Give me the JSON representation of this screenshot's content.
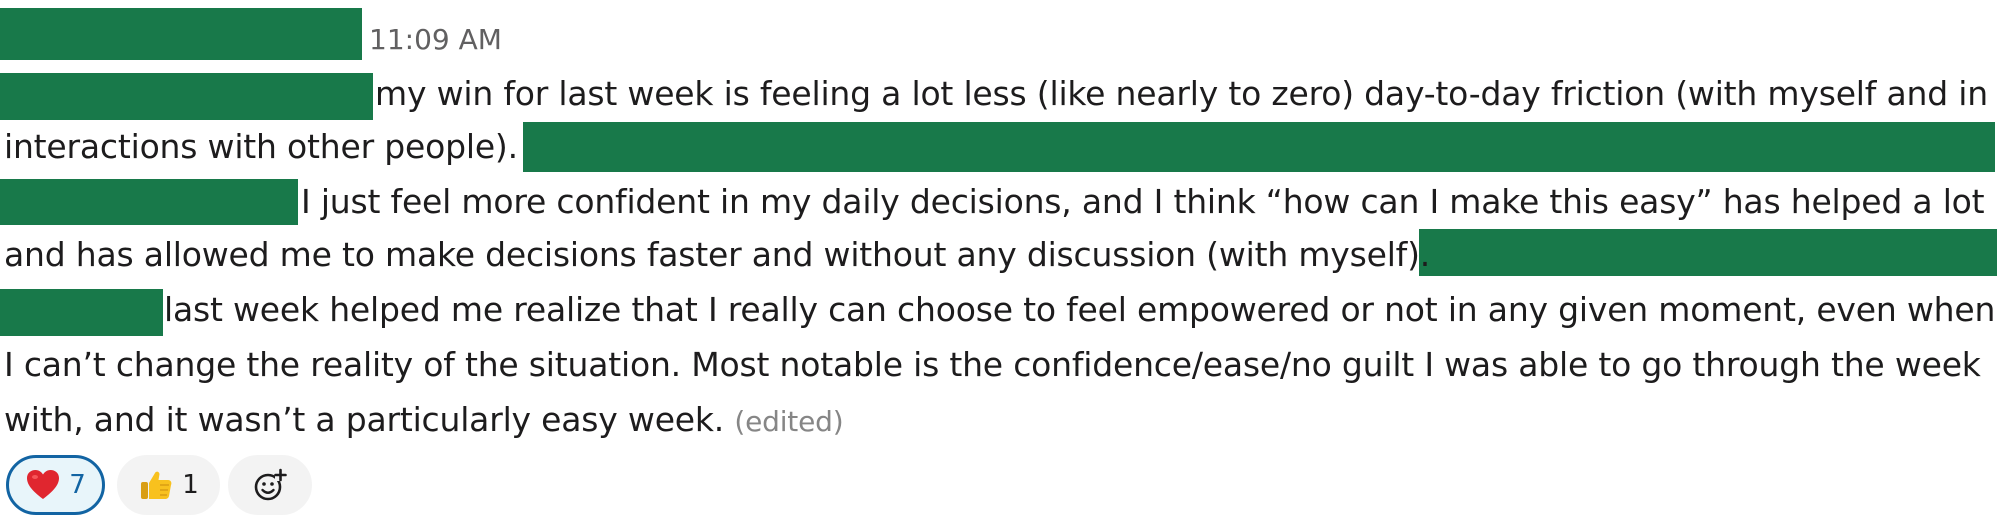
{
  "message": {
    "timestamp": "11:09 AM",
    "lines": [
      "my win for last week is feeling a lot less (like nearly to zero) day-to-day friction (with myself and in",
      "interactions with other people).",
      "I just feel more confident in my daily decisions, and I think “how can I make this easy” has helped a lot",
      "and has allowed me to make decisions faster and without any discussion (with myself).",
      "last week helped me realize that I really can choose to feel empowered or not in any given moment, even when",
      "I can’t change the reality of the situation. Most notable is the confidence/ease/no guilt I was able to go through the week",
      "with, and it wasn’t a particularly easy week."
    ],
    "edited_label": "(edited)"
  },
  "reactions": [
    {
      "emoji": "heart-emoji",
      "count": "7",
      "active": true
    },
    {
      "emoji": "thumbs-up-emoji",
      "count": "1",
      "active": false
    },
    {
      "emoji": "add-reaction-icon",
      "count": "",
      "active": false
    }
  ],
  "colors": {
    "redaction": "#18794a",
    "text": "#1d1c1d",
    "muted": "#616061",
    "active_reaction_border": "#1264a3"
  }
}
